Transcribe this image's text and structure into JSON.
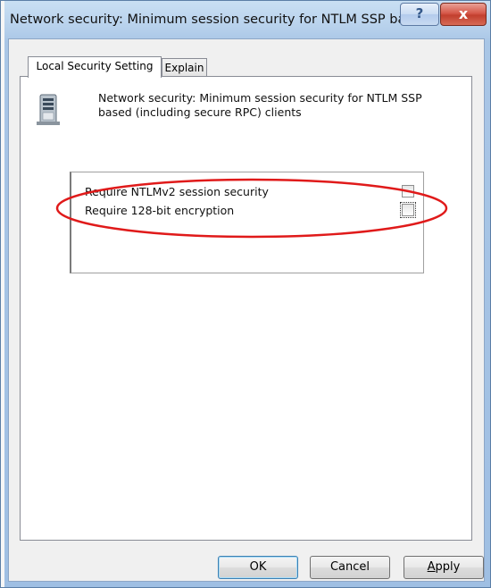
{
  "window": {
    "title": "Network security: Minimum session security for NTLM SSP ba...",
    "help_glyph": "?",
    "close_glyph": "x"
  },
  "tabs": [
    {
      "label": "Local Security Setting",
      "active": true
    },
    {
      "label": "Explain",
      "active": false
    }
  ],
  "policy": {
    "icon": "server-policy-icon",
    "description": "Network security: Minimum session security for NTLM SSP based (including secure RPC) clients"
  },
  "options": [
    {
      "label": "Require NTLMv2 session security",
      "checked": false
    },
    {
      "label": "Require 128-bit encryption",
      "checked": false
    }
  ],
  "annotation": {
    "color": "#e01a1a",
    "shape": "ellipse"
  },
  "buttons": {
    "ok": "OK",
    "cancel": "Cancel",
    "apply_prefix": "",
    "apply_mnemonic": "A",
    "apply_rest": "pply"
  }
}
